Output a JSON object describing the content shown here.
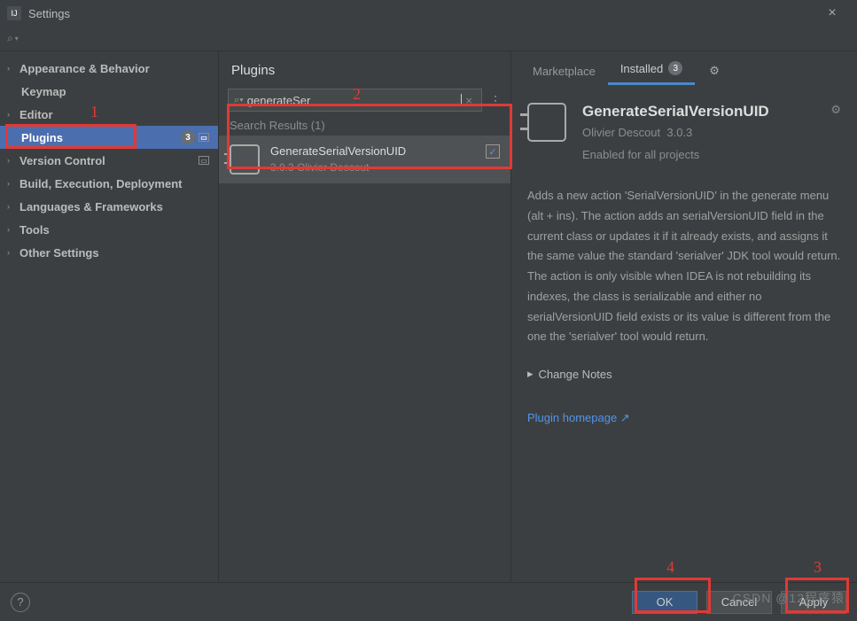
{
  "window": {
    "title": "Settings"
  },
  "sidebar": {
    "items": [
      {
        "label": "Appearance & Behavior",
        "exp": true
      },
      {
        "label": "Keymap",
        "exp": false,
        "lvl": 2
      },
      {
        "label": "Editor",
        "exp": true
      },
      {
        "label": "Plugins",
        "exp": false,
        "lvl": 2,
        "sel": true,
        "badge": "3"
      },
      {
        "label": "Version Control",
        "exp": true,
        "trail": true
      },
      {
        "label": "Build, Execution, Deployment",
        "exp": true
      },
      {
        "label": "Languages & Frameworks",
        "exp": true
      },
      {
        "label": "Tools",
        "exp": true
      },
      {
        "label": "Other Settings",
        "exp": true
      }
    ]
  },
  "middle": {
    "title": "Plugins",
    "search": "generateSer",
    "results_label": "Search Results (1)",
    "result": {
      "name": "GenerateSerialVersionUID",
      "meta": "3.0.3  Olivier Descout"
    }
  },
  "detail": {
    "tabs": {
      "marketplace": "Marketplace",
      "installed": "Installed",
      "installed_count": "3"
    },
    "name": "GenerateSerialVersionUID",
    "author": "Olivier Descout",
    "version": "3.0.3",
    "enabled": "Enabled for all projects",
    "description": "Adds a new action 'SerialVersionUID' in the generate menu (alt + ins). The action adds an serialVersionUID field in the current class or updates it if it already exists, and assigns it the same value the standard 'serialver' JDK tool would return. The action is only visible when IDEA is not rebuilding its indexes, the class is serializable and either no serialVersionUID field exists or its value is different from the one the 'serialver' tool would return.",
    "change_notes": "Change Notes",
    "homepage": "Plugin homepage ↗"
  },
  "footer": {
    "ok": "OK",
    "cancel": "Cancel",
    "apply": "Apply"
  },
  "annotations": {
    "a1": "1",
    "a2": "2",
    "a3": "3",
    "a4": "4"
  },
  "watermark": "CSDN @12程序猿"
}
